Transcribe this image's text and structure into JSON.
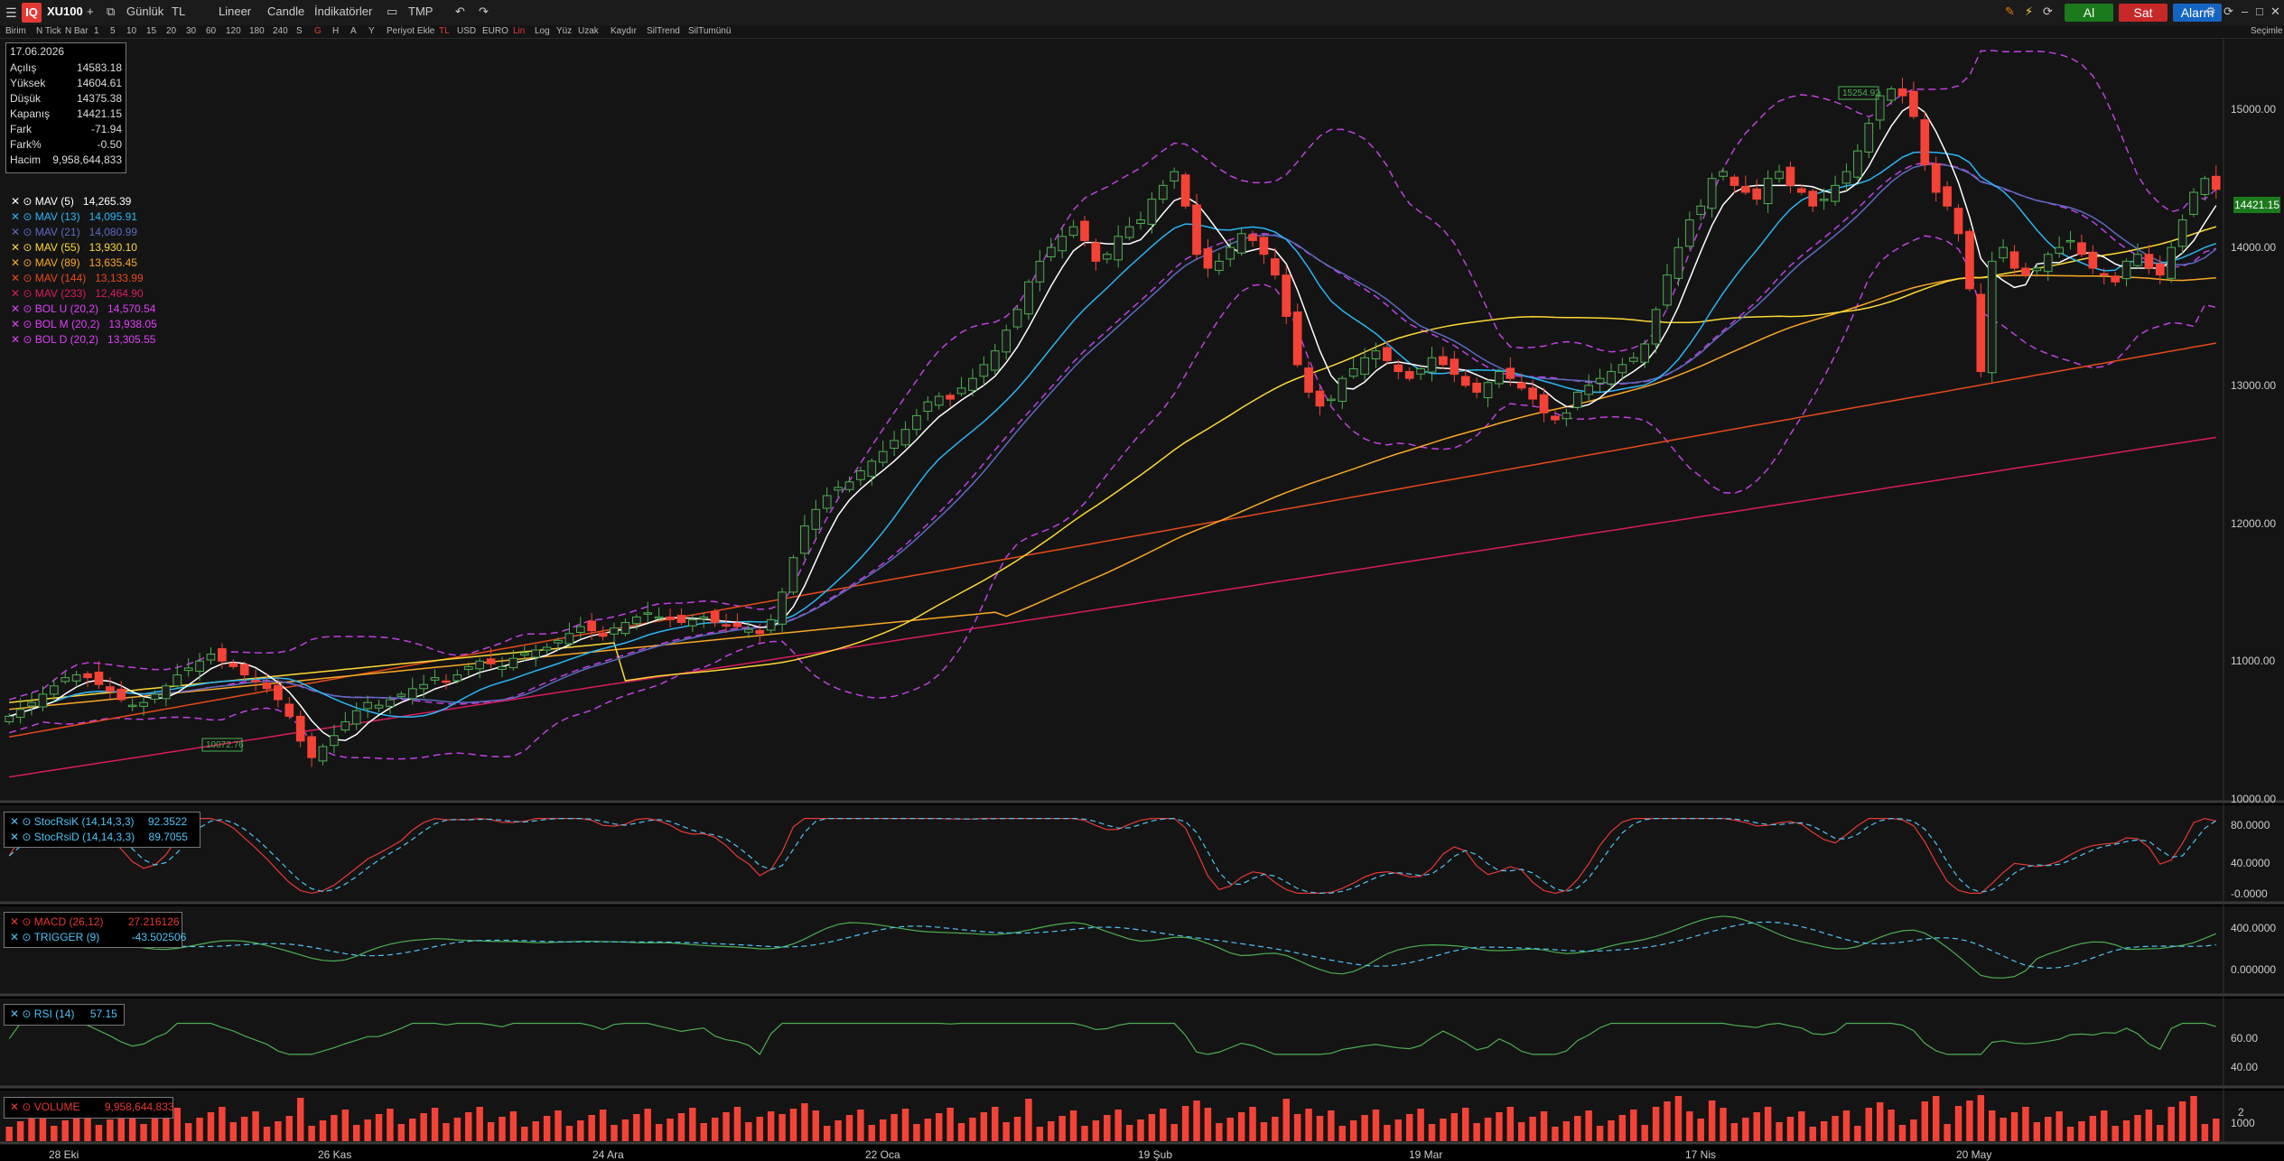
{
  "toolbar": {
    "symbol": "XU100",
    "period": "Günlük",
    "currency": "TL",
    "line_type": "Lineer",
    "candle_label": "Candle",
    "indicators_label": "İndikatörler",
    "tmp_label": "TMP",
    "buy_label": "Al",
    "sell_label": "Sat",
    "alarm_label": "Alarm",
    "colors": {
      "buy": "#1b7a1b",
      "sell": "#c62828",
      "alarm": "#1565c0"
    }
  },
  "toolbar2": {
    "items": [
      "Birim",
      "N Tick",
      "N Bar",
      "1",
      "5",
      "10",
      "15",
      "20",
      "30",
      "60",
      "120",
      "180",
      "240",
      "S",
      "G",
      "H",
      "A",
      "Y",
      "Periyot Ekle",
      "TL",
      "USD",
      "EURO",
      "Lin",
      "Log",
      "Yüz",
      "Uzak",
      "Kaydır",
      "SilTrend",
      "SilTumünü"
    ],
    "right_label": "Seçimle"
  },
  "ohlc": {
    "date": "17.06.2026",
    "rows": [
      {
        "k": "Açılış",
        "v": "14583.18"
      },
      {
        "k": "Yüksek",
        "v": "14604.61"
      },
      {
        "k": "Düşük",
        "v": "14375.38"
      },
      {
        "k": "Kapanış",
        "v": "14421.15"
      },
      {
        "k": "Fark",
        "v": "-71.94"
      },
      {
        "k": "Fark%",
        "v": "-0.50"
      },
      {
        "k": "Hacim",
        "v": "9,958,644,833"
      }
    ]
  },
  "legend": [
    {
      "name": "MAV (5)",
      "value": "14,265.39",
      "color": "#ffffff"
    },
    {
      "name": "MAV (13)",
      "value": "14,095.91",
      "color": "#29b6f6"
    },
    {
      "name": "MAV (21)",
      "value": "14,080.99",
      "color": "#5c6bc0"
    },
    {
      "name": "MAV (55)",
      "value": "13,930.10",
      "color": "#fdd835"
    },
    {
      "name": "MAV (89)",
      "value": "13,635.45",
      "color": "#f9a825"
    },
    {
      "name": "MAV (144)",
      "value": "13,133.99",
      "color": "#e64a19"
    },
    {
      "name": "MAV (233)",
      "value": "12,464.90",
      "color": "#d81b60"
    },
    {
      "name": "BOL U (20,2)",
      "value": "14,570.54",
      "color": "#e040fb"
    },
    {
      "name": "BOL M (20,2)",
      "value": "13,938.05",
      "color": "#e040fb"
    },
    {
      "name": "BOL D (20,2)",
      "value": "13,305.55",
      "color": "#e040fb"
    }
  ],
  "last_price": "14421.15",
  "price_axis": [
    "15000.00",
    "14000.00",
    "13000.00",
    "12000.00",
    "11000.00",
    "10000.00"
  ],
  "high_marker": "15254.92",
  "low_marker": "10072.76",
  "date_axis": [
    "28 Eki",
    "26 Kas",
    "24 Ara",
    "22 Oca",
    "19 Şub",
    "19 Mar",
    "17 Nis",
    "20 May"
  ],
  "stoch": {
    "k_label": "StocRsiK (14,14,3,3)",
    "k_value": "92.3522",
    "d_label": "StocRsiD (14,14,3,3)",
    "d_value": "89.7055",
    "axis": [
      "80.0000",
      "40.0000",
      "-0.0000"
    ]
  },
  "macd": {
    "macd_label": "MACD (26,12)",
    "macd_value": "27.216126",
    "trigger_label": "TRIGGER (9)",
    "trigger_value": "-43.502506",
    "axis": [
      "400.0000",
      "0.000000"
    ]
  },
  "rsi": {
    "label": "RSI (14)",
    "value": "57.15",
    "axis": [
      "60.00",
      "40.00"
    ]
  },
  "volume": {
    "label": "VOLUME",
    "value": "9,958,644,833",
    "axis": [
      "2",
      "1000"
    ]
  },
  "chart_data": {
    "type": "candlestick",
    "title": "XU100",
    "ylim": [
      10000,
      15500
    ],
    "closes": [
      10600,
      10650,
      10700,
      10760,
      10820,
      10880,
      10900,
      10880,
      10830,
      10780,
      10720,
      10680,
      10700,
      10760,
      10820,
      10900,
      10950,
      11000,
      11050,
      11000,
      10960,
      10900,
      10850,
      10800,
      10720,
      10600,
      10420,
      10300,
      10380,
      10460,
      10560,
      10640,
      10700,
      10680,
      10720,
      10760,
      10800,
      10830,
      10880,
      10850,
      10900,
      10960,
      11000,
      10980,
      10960,
      11020,
      11060,
      11080,
      11100,
      11150,
      11200,
      11250,
      11220,
      11180,
      11240,
      11280,
      11320,
      11350,
      11320,
      11300,
      11280,
      11300,
      11320,
      11280,
      11260,
      11250,
      11230,
      11200,
      11300,
      11500,
      11750,
      11980,
      12100,
      12200,
      12260,
      12300,
      12380,
      12450,
      12520,
      12600,
      12680,
      12780,
      12880,
      12920,
      12900,
      12980,
      13050,
      13150,
      13250,
      13400,
      13550,
      13750,
      13900,
      14000,
      14080,
      14150,
      14050,
      13900,
      13950,
      14080,
      14150,
      14200,
      14350,
      14450,
      14550,
      14300,
      13950,
      13850,
      13900,
      14000,
      14100,
      14050,
      13950,
      13800,
      13500,
      13150,
      12950,
      12850,
      12900,
      13050,
      13120,
      13200,
      13250,
      13180,
      13100,
      13050,
      13120,
      13200,
      13150,
      13080,
      13000,
      12950,
      13020,
      13100,
      13050,
      12980,
      12900,
      12800,
      12750,
      12800,
      12950,
      13000,
      13050,
      13100,
      13150,
      13200,
      13300,
      13550,
      13800,
      14000,
      14200,
      14300,
      14500,
      14550,
      14450,
      14400,
      14350,
      14500,
      14550,
      14450,
      14400,
      14300,
      14350,
      14450,
      14550,
      14700,
      14900,
      15100,
      15150,
      15100,
      14950,
      14600,
      14400,
      14300,
      14100,
      13700,
      13100,
      13900,
      14000,
      13850,
      13800,
      13850,
      13950,
      14000,
      14050,
      13950,
      13850,
      13800,
      13750,
      13900,
      13950,
      13850,
      13800,
      14000,
      14200,
      14400,
      14500,
      14421
    ],
    "ma_periods": [
      5,
      13,
      21,
      55,
      89,
      144,
      233
    ]
  }
}
